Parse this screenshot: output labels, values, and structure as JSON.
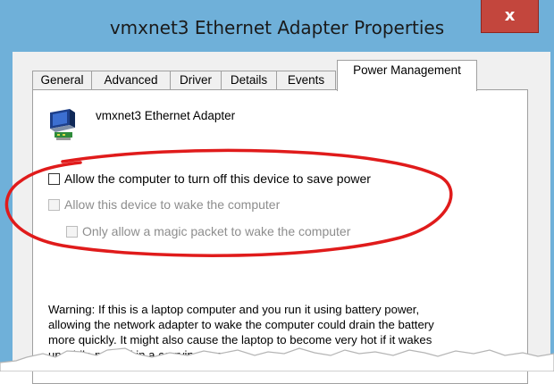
{
  "window": {
    "title": "vmxnet3 Ethernet Adapter Properties",
    "close_glyph": "x"
  },
  "tabs": [
    {
      "label": "General",
      "active": false
    },
    {
      "label": "Advanced",
      "active": false
    },
    {
      "label": "Driver",
      "active": false
    },
    {
      "label": "Details",
      "active": false
    },
    {
      "label": "Events",
      "active": false
    },
    {
      "label": "Power Management",
      "active": true
    }
  ],
  "device": {
    "name": "vmxnet3 Ethernet Adapter",
    "icon": "network-adapter-icon"
  },
  "options": [
    {
      "label": "Allow the computer to turn off this device to save power",
      "checked": false,
      "enabled": true
    },
    {
      "label": "Allow this device to wake the computer",
      "checked": false,
      "enabled": false
    },
    {
      "label": "Only allow a magic packet to wake the computer",
      "checked": false,
      "enabled": false
    }
  ],
  "warning_lines": [
    "Warning: If this is a laptop computer and you run it using battery power,",
    "allowing the network adapter to wake the computer could drain the battery",
    "more quickly. It might also cause the laptop to become very hot if it wakes",
    "up while packed in a carrying case."
  ],
  "colors": {
    "titlebar": "#6fb0d9",
    "close_button": "#c3463d",
    "annotation": "#e01b1b"
  }
}
